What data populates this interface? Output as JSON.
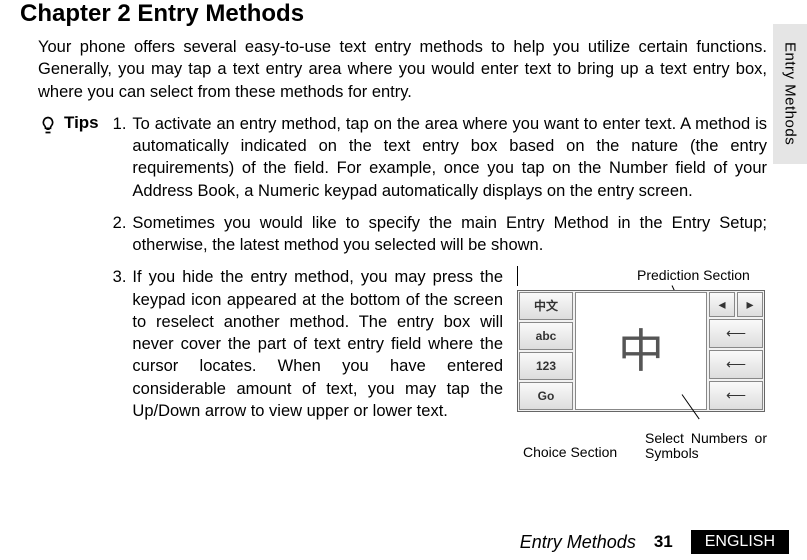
{
  "chapter_title": "Chapter 2 Entry Methods",
  "intro": "Your phone offers several easy-to-use text entry methods to help you utilize certain functions. Generally, you may tap a text entry area where you would enter text to bring up a text entry box, where you can select from these methods for entry.",
  "tips_label": "Tips",
  "tips": [
    {
      "num": "1.",
      "text": "To activate an entry method, tap on the area where you want to enter text. A method is automatically indicated on the text entry box based on the nature (the entry requirements) of the field. For example, once you tap on the Number field of your Address Book, a Numeric keypad automatically displays on the entry screen."
    },
    {
      "num": "2.",
      "text": "Sometimes you would like to specify the main Entry Method in the Entry Setup; otherwise, the latest method you selected will be shown."
    },
    {
      "num": "3.",
      "text": "If you hide the entry method, you may press the keypad icon appeared at the bottom of the screen to reselect another method. The entry box will never cover the part of text entry field where the cursor locates. When you have entered considerable amount of text, you may tap the Up/Down arrow to view upper or lower text."
    }
  ],
  "figure": {
    "prediction_label": "Prediction Section",
    "choice_label": "Choice Section",
    "select_label": "Select Numbers or Symbols",
    "left_cells": [
      "中文",
      "abc",
      "123",
      "Go"
    ],
    "mid_char": "中",
    "right_arrows": [
      "◂",
      "▸",
      "⟵",
      "⟵",
      "⟵"
    ]
  },
  "side_tab": "Entry Methods",
  "footer": {
    "title": "Entry Methods",
    "page": "31",
    "lang": "ENGLISH"
  }
}
